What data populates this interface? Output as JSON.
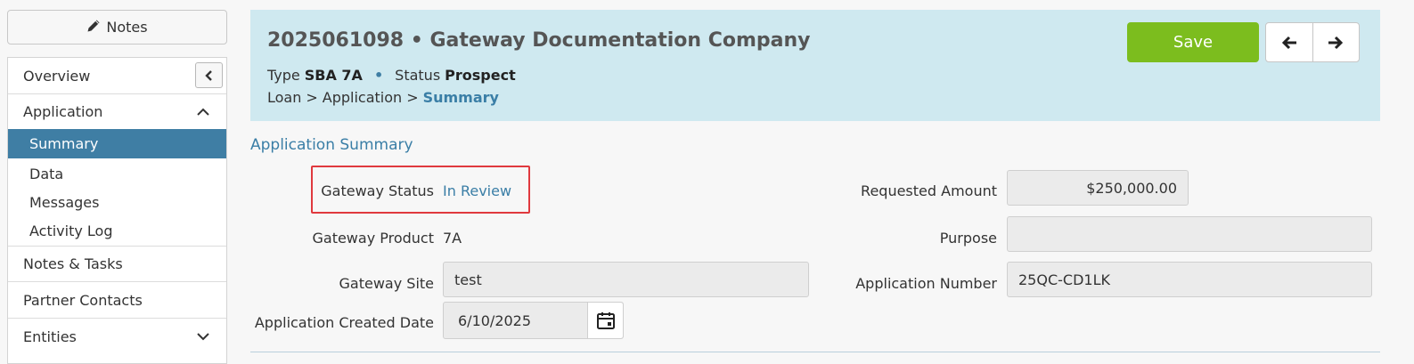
{
  "notes_button": {
    "label": "Notes",
    "icon": "pencil-icon"
  },
  "sidebar": {
    "collapse_icon": "chevron-left-icon",
    "items": [
      {
        "label": "Overview"
      },
      {
        "label": "Application",
        "icon": "chevron-up-icon"
      },
      {
        "label": "Summary",
        "active": true
      },
      {
        "label": "Data"
      },
      {
        "label": "Messages"
      },
      {
        "label": "Activity Log"
      },
      {
        "label": "Notes & Tasks"
      },
      {
        "label": "Partner Contacts"
      },
      {
        "label": "Entities",
        "icon": "chevron-down-icon"
      }
    ]
  },
  "header": {
    "title": "2025061098 • Gateway Documentation Company",
    "type_label": "Type",
    "type_value": "SBA 7A",
    "separator": "•",
    "status_label": "Status",
    "status_value": "Prospect",
    "breadcrumb": [
      "Loan",
      ">",
      "Application",
      ">",
      "Summary"
    ],
    "save_label": "Save",
    "prev_icon": "arrow-left-icon",
    "next_icon": "arrow-right-icon",
    "background_color": "#cfe9f0",
    "save_color": "#7cbd1e"
  },
  "section": {
    "title": "Application Summary",
    "gateway_status": {
      "label": "Gateway Status",
      "value": "In Review"
    },
    "gateway_product": {
      "label": "Gateway Product",
      "value": "7A"
    },
    "gateway_site": {
      "label": "Gateway Site",
      "value": "test"
    },
    "created_date": {
      "label": "Application Created Date",
      "value": "6/10/2025",
      "icon": "calendar-icon"
    },
    "requested_amount": {
      "label": "Requested Amount",
      "value": "$250,000.00"
    },
    "purpose": {
      "label": "Purpose",
      "value": ""
    },
    "application_number": {
      "label": "Application Number",
      "value": "25QC-CD1LK"
    }
  },
  "accent_color": "#3a7ea6",
  "highlight_color": "#e0393e"
}
